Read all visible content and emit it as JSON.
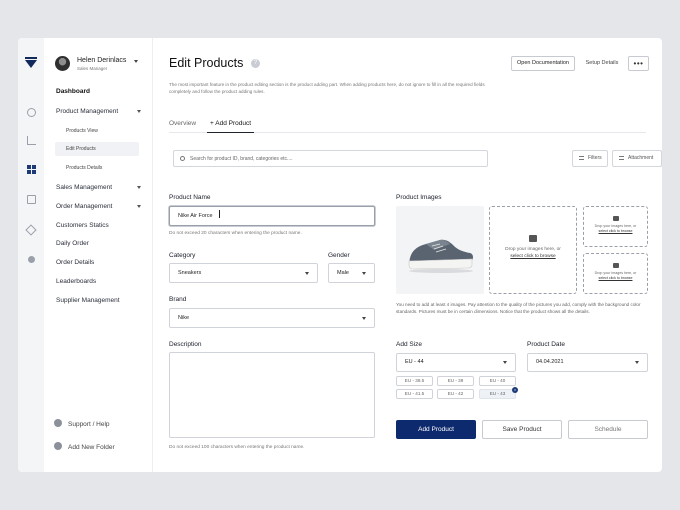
{
  "colors": {
    "accent": "#0e2a6e",
    "background": "#e4e6ea",
    "panel": "#ffffff"
  },
  "rail": {
    "icons": [
      "logo-icon",
      "circle-icon",
      "chart-icon",
      "grid-icon",
      "document-icon",
      "cube-icon",
      "dot-icon"
    ]
  },
  "user": {
    "name": "Helen Derinlacs",
    "role": "Sales Manager"
  },
  "sidebar": {
    "dashboard": "Dashboard",
    "product_management": "Product Management",
    "products_view": "Products View",
    "edit_products": "Edit Products",
    "products_details": "Products Details",
    "sales_management": "Sales Management",
    "order_management": "Order Management",
    "customers_statics": "Customers Statics",
    "daily_order": "Daily Order",
    "order_details": "Order Details",
    "leaderboards": "Leaderboards",
    "supplier_management": "Supplier Management",
    "support": "Support / Help",
    "add_folder": "Add New Folder"
  },
  "header": {
    "title": "Edit Products",
    "help_glyph": "?",
    "open_docs": "Open Documentation",
    "setup": "Setup Details",
    "more": "•••",
    "description": "The most important feature in the product editing section is the product adding part. When adding products here, do not ignore to fill in all the required fields completely and follow the product adding rules."
  },
  "tabs": {
    "overview": "Overview",
    "add_product": "+ Add Product"
  },
  "search": {
    "placeholder": "Search for product ID, brand, categories etc....",
    "filters": "Filters",
    "attachment": "Attachment"
  },
  "form": {
    "product_name_label": "Product Name",
    "product_name_value": "Nike Air Force",
    "product_name_hint": "Do not exceed 20 characters when entering the product name.",
    "category_label": "Category",
    "category_value": "Sneakers",
    "gender_label": "Gender",
    "gender_value": "Male",
    "brand_label": "Brand",
    "brand_value": "Nike",
    "description_label": "Description",
    "description_hint": "Do not exceed 100 characters when entering the product name."
  },
  "images": {
    "label": "Product Images",
    "drop_text": "Drop your images here, or",
    "drop_action": "select click to browse",
    "drop_small_text": "Drop your images here, or",
    "drop_small_action": "select click to browse",
    "note": "You need to add at least 4 images. Pay attention to the quality of the pictures you add, comply with the background color standards. Pictures must be in certain dimensions. Notice that the product shows all the details."
  },
  "size": {
    "label": "Add Size",
    "selected": "EU - 44",
    "chips": [
      "EU - 38.5",
      "EU - 39",
      "EU - 40",
      "EU - 41.5",
      "EU - 42",
      "EU - 43"
    ],
    "active_chip": "EU - 43",
    "remove_glyph": "×"
  },
  "date": {
    "label": "Product Date",
    "value": "04.04.2021"
  },
  "actions": {
    "add": "Add Product",
    "save": "Save Product",
    "schedule": "Schedule"
  }
}
